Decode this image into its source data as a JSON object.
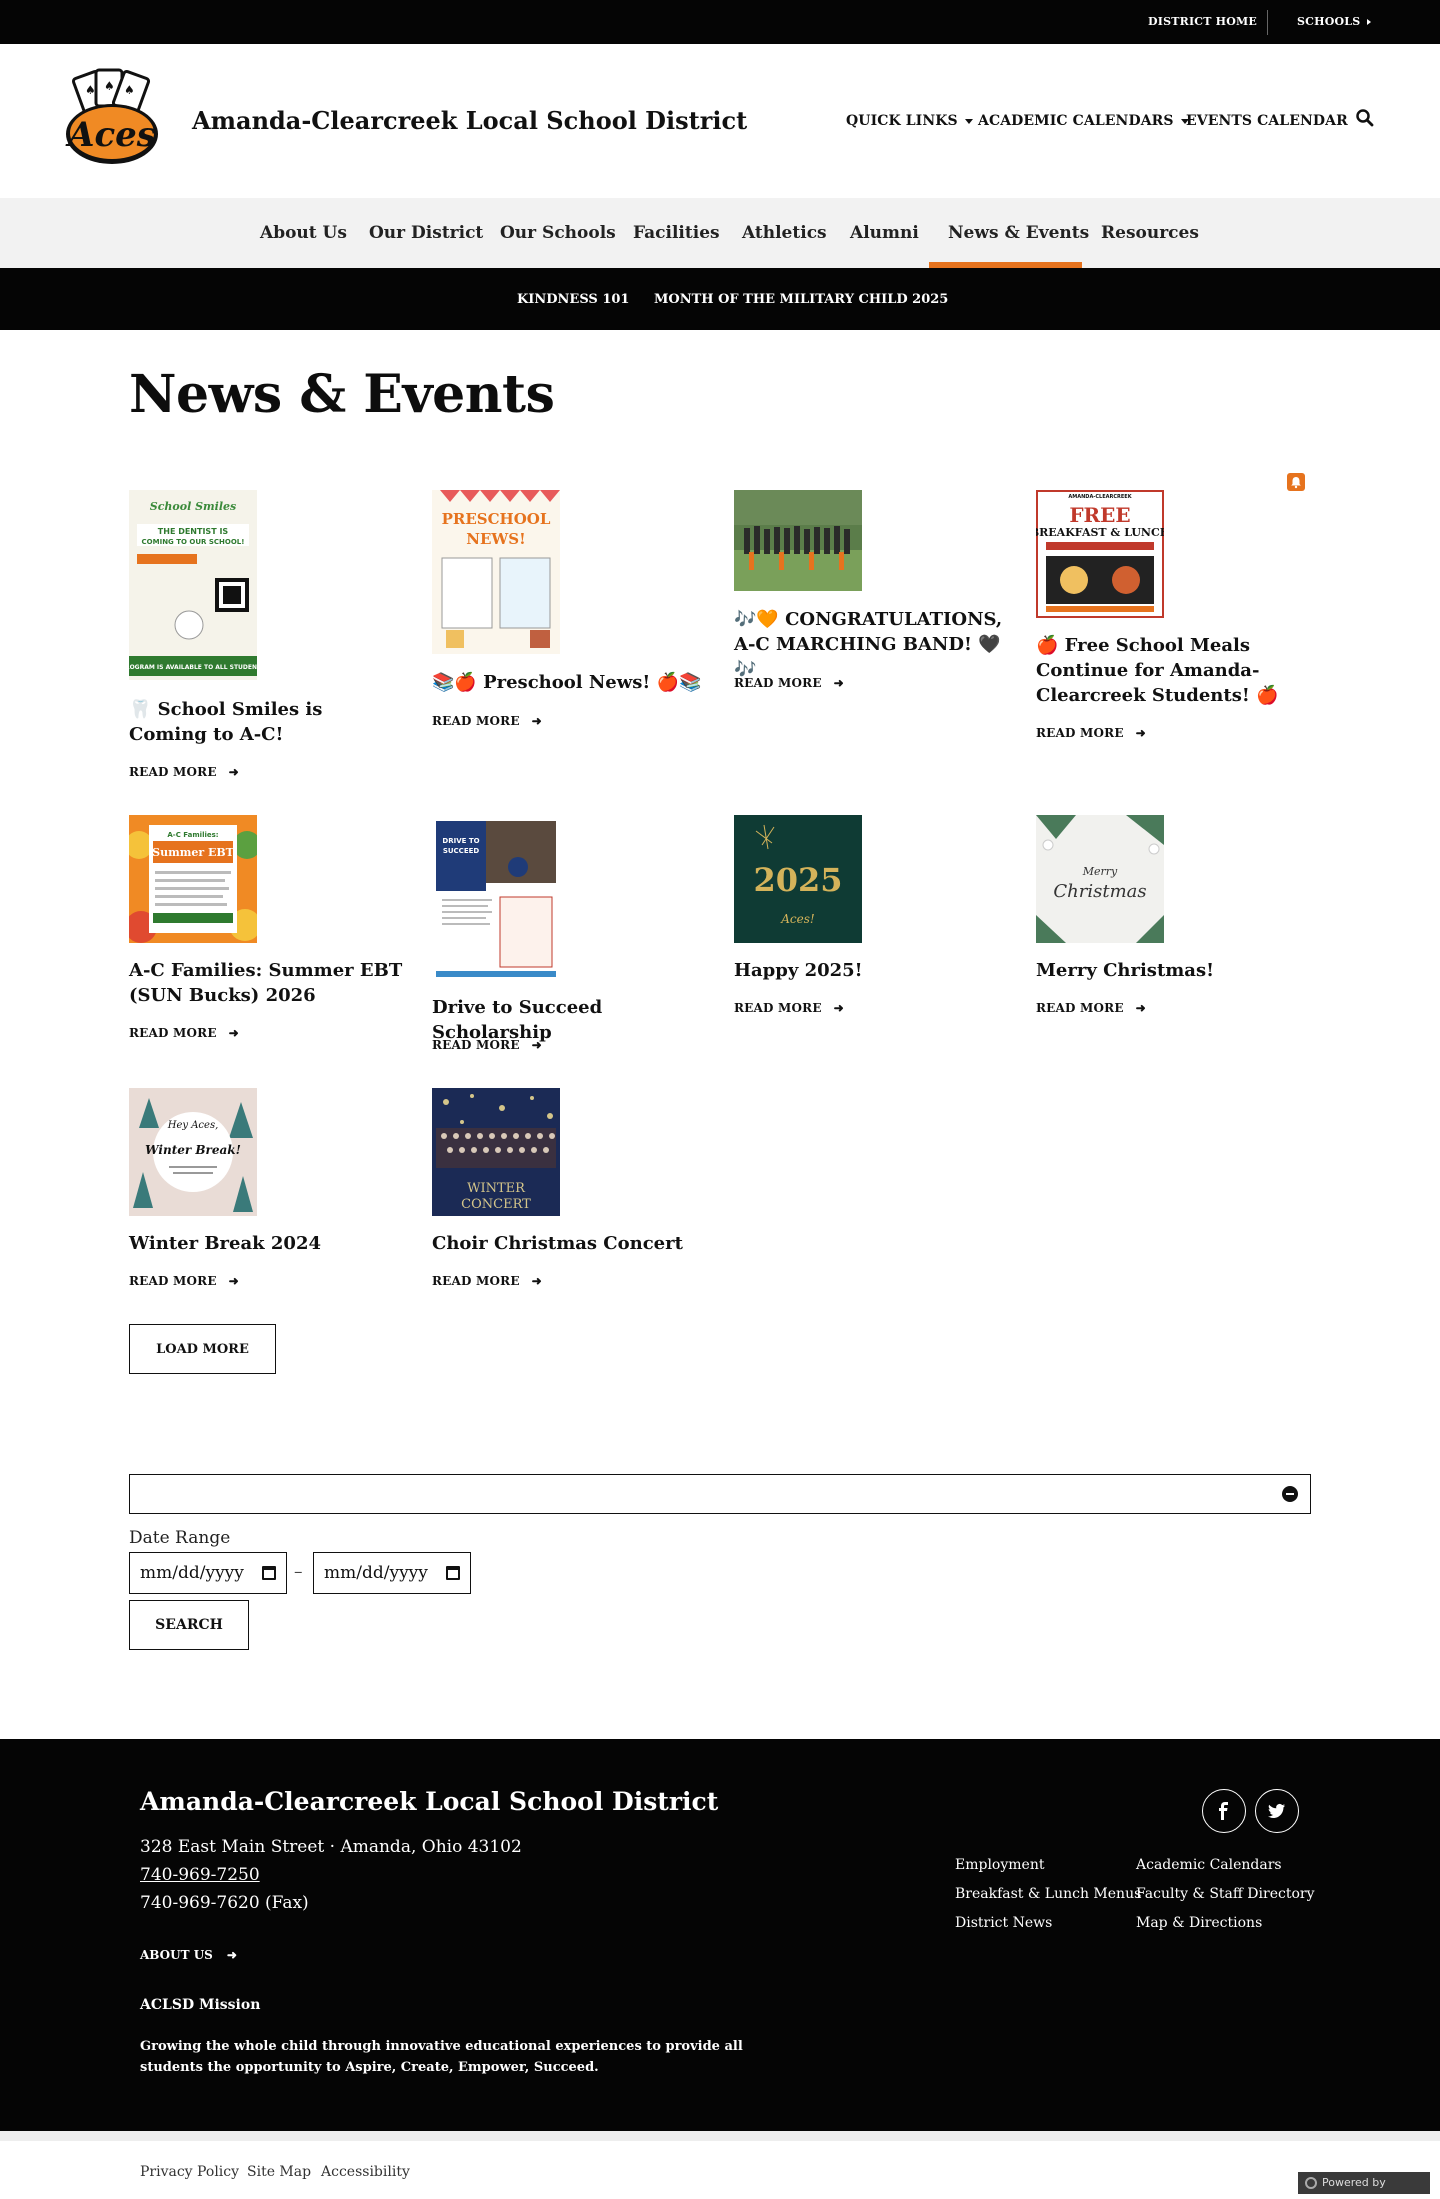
{
  "topbar": {
    "district_home": "DISTRICT HOME",
    "schools": "SCHOOLS"
  },
  "header": {
    "site_title": "Amanda-Clearcreek Local School District",
    "quick_links": "QUICK LINKS",
    "academic_calendars": "ACADEMIC CALENDARS",
    "events_calendar": "EVENTS CALENDAR",
    "logo_text": "Aces"
  },
  "nav": {
    "items": [
      "About Us",
      "Our District",
      "Our Schools",
      "Facilities",
      "Athletics",
      "Alumni",
      "News & Events",
      "Resources"
    ],
    "active": "News & Events",
    "accent": "#e6731e"
  },
  "subnav": {
    "items": [
      "KINDNESS 101",
      "MONTH OF THE MILITARY CHILD 2025"
    ]
  },
  "page": {
    "title": "News & Events",
    "read_more": "READ MORE"
  },
  "posts": [
    {
      "title": "🦷 School Smiles is Coming to A-C!",
      "thumb_text": "School Smiles · THE DENTIST IS COMING TO OUR SCHOOL!"
    },
    {
      "title": "📚🍎 Preschool News! 🍎📚",
      "thumb_text": "PRESCHOOL NEWS!"
    },
    {
      "title": "🎶🧡 CONGRATULATIONS, A-C MARCHING BAND! 🖤🎶",
      "thumb_text": ""
    },
    {
      "title": "🍎 Free School Meals Continue for Amanda-Clearcreek Students! 🍎",
      "thumb_text": "FREE BREAKFAST & LUNCH"
    },
    {
      "title": "A-C Families: Summer EBT (SUN Bucks) 2026",
      "thumb_text": "Summer EBT"
    },
    {
      "title": "Drive to Succeed Scholarship",
      "thumb_text": "DRIVE TO SUCCEED"
    },
    {
      "title": "Happy 2025!",
      "thumb_text": "2025"
    },
    {
      "title": "Merry Christmas!",
      "thumb_text": "Merry Christmas"
    },
    {
      "title": "Winter Break 2024",
      "thumb_text": "Winter Break!"
    },
    {
      "title": "Choir Christmas Concert",
      "thumb_text": "WINTER CONCERT"
    }
  ],
  "load_more": "LOAD MORE",
  "filter": {
    "date_range_label": "Date Range",
    "start_placeholder": "mm/dd/yyyy",
    "end_placeholder": "mm/dd/yyyy",
    "dash": "–",
    "search": "SEARCH"
  },
  "footer": {
    "title": "Amanda-Clearcreek Local School District",
    "address": "328 East Main Street · Amanda, Ohio  43102",
    "phone": "740-969-7250",
    "fax": "740-969-7620 (Fax)",
    "about": "ABOUT US",
    "mission_heading": "ACLSD Mission",
    "mission": "Growing the whole child through innovative educational experiences to provide all students the opportunity to Aspire, Create, Empower, Succeed.",
    "links": [
      "Employment",
      "Academic Calendars",
      "Breakfast & Lunch Menus",
      "Faculty & Staff Directory",
      "District News",
      "Map & Directions"
    ]
  },
  "bottom": {
    "links": [
      "Privacy Policy",
      "Site Map",
      "Accessibility"
    ],
    "powered": "Powered by Finalsite"
  }
}
